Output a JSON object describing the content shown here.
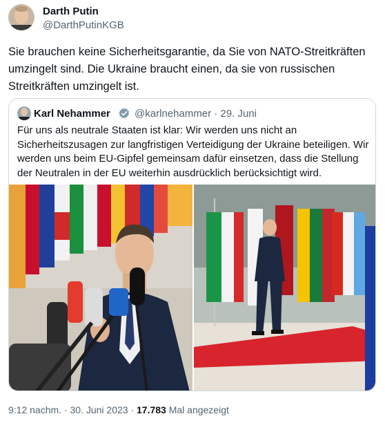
{
  "author": {
    "display_name": "Darth Putin",
    "handle": "@DarthPutinKGB",
    "avatar_icon": "portrait-photo"
  },
  "tweet": {
    "text": "Sie brauchen keine Sicherheitsgarantie, da Sie von NATO-Streitkräften umzingelt sind. Die Ukraine braucht einen, da sie von russischen Streitkräften umzingelt ist."
  },
  "quoted": {
    "display_name": "Karl Nehammer",
    "verified_icon": "verified-badge-icon",
    "handle_date": "@karlnehammer · 29. Juni",
    "text": "Für uns als neutrale Staaten ist klar: Wir werden uns nicht an Sicherheitszusagen zur langfristigen Verteidigung der Ukraine beteiligen. Wir werden uns beim EU-Gipfel gemeinsam dafür einsetzen, dass die Stellung der Neutralen in der EU weiterhin ausdrücklich berücksichtigt wird.",
    "images": [
      "press-conference-photo",
      "red-carpet-flags-photo"
    ]
  },
  "footer": {
    "time_date": "9:12 nachm. · 30. Juni 2023 · ",
    "views_count": "17.783",
    "views_label": " Mal angezeigt"
  },
  "colors": {
    "text": "#0f1419",
    "secondary": "#536471",
    "border": "#cfd9de",
    "verified": "#829aab"
  }
}
